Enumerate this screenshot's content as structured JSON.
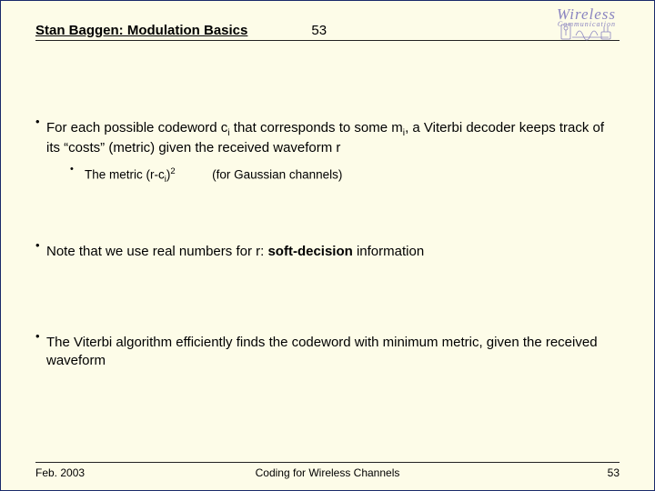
{
  "header": {
    "title": "Stan Baggen: Modulation Basics",
    "page_number": "53"
  },
  "brand": {
    "line1": "Wireless",
    "line2": "Communication"
  },
  "bullets": [
    {
      "pre": "For each possible codeword c",
      "sub1": "i",
      "mid1": " that corresponds to some m",
      "sub2": "i",
      "mid2": ", a Viterbi decoder keeps track of its “costs” (metric) given the received waveform r",
      "sub": {
        "pre": "The metric (r-c",
        "ssub": "i",
        "post1": ")",
        "ssup": "2",
        "spacer": "   ",
        "tail": "(for Gaussian channels)"
      }
    },
    {
      "pre": "Note that we use real numbers for r: ",
      "bold": "soft-decision",
      "post": " information"
    },
    {
      "text": "The Viterbi algorithm efficiently finds the codeword with minimum metric, given the received waveform"
    }
  ],
  "footer": {
    "left": "Feb. 2003",
    "center": "Coding for Wireless Channels",
    "right": "53"
  }
}
